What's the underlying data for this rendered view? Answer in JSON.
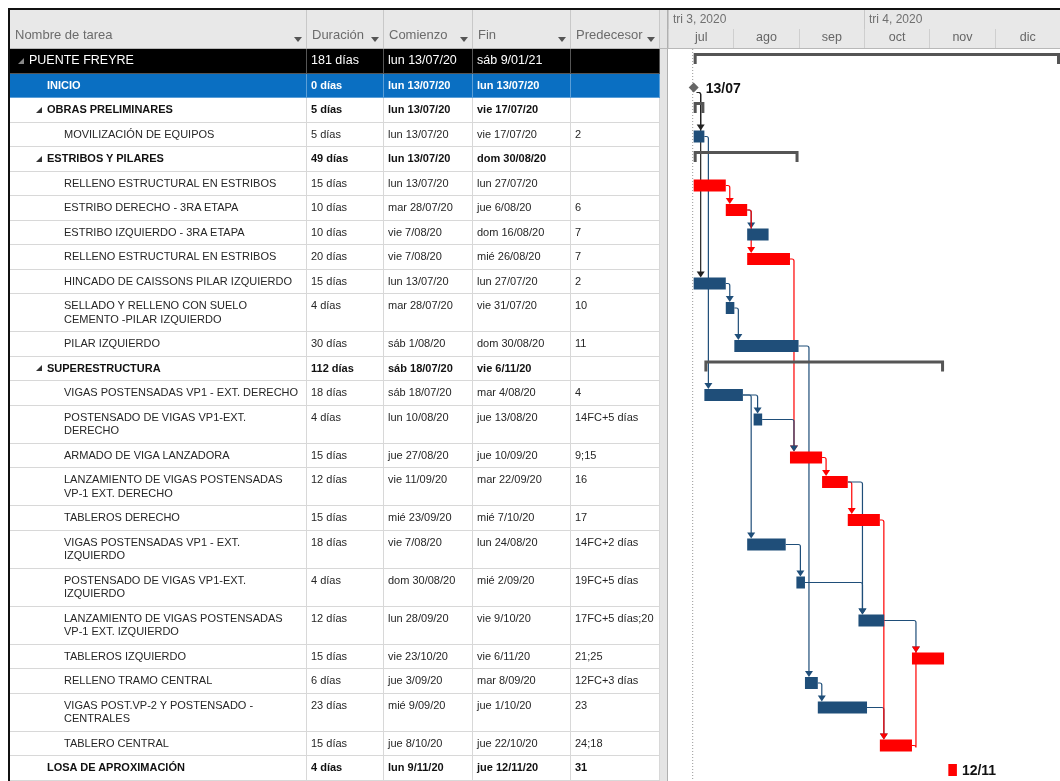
{
  "columns": [
    {
      "label": "Nombre de tarea"
    },
    {
      "label": "Duración"
    },
    {
      "label": "Comienzo"
    },
    {
      "label": "Fin"
    },
    {
      "label": "Predecesor"
    }
  ],
  "timescale": {
    "quarters": [
      {
        "label": "tri 3, 2020"
      },
      {
        "label": "tri 4, 2020"
      }
    ],
    "months": [
      "jul",
      "ago",
      "sep",
      "oct",
      "nov",
      "dic"
    ]
  },
  "tasks": [
    {
      "kind": "project",
      "name": "PUENTE FREYRE",
      "duration": "181 días",
      "start": "lun 13/07/20",
      "finish": "sáb 9/01/21",
      "bold": false,
      "selected": false,
      "expanded": true,
      "children": [
        {
          "kind": "milestone",
          "name": "INICIO",
          "duration": "0 días",
          "start": "lun 13/07/20",
          "finish": "lun 13/07/20",
          "bold": true,
          "selected": true,
          "bar_label": "13/07"
        },
        {
          "kind": "summary",
          "name": "OBRAS PRELIMINARES",
          "duration": "5 días",
          "start": "lun 13/07/20",
          "finish": "vie 17/07/20",
          "bold": true,
          "selected": false,
          "expanded": true,
          "children": [
            {
              "kind": "task",
              "name": "MOVILIZACIÓN DE EQUIPOS",
              "duration": "5 días",
              "start": "lun 13/07/20",
              "finish": "vie 17/07/20",
              "predecessors": "2",
              "bold": false,
              "selected": false,
              "critical": false
            }
          ]
        },
        {
          "kind": "summary",
          "name": "ESTRIBOS Y PILARES",
          "duration": "49 días",
          "start": "lun 13/07/20",
          "finish": "dom 30/08/20",
          "bold": true,
          "selected": false,
          "expanded": true,
          "children": [
            {
              "kind": "task",
              "name": "RELLENO ESTRUCTURAL EN ESTRIBOS",
              "duration": "15 días",
              "start": "lun 13/07/20",
              "finish": "lun 27/07/20",
              "bold": false,
              "selected": false,
              "critical": true
            },
            {
              "kind": "task",
              "name": "ESTRIBO DERECHO - 3RA ETAPA",
              "duration": "10 días",
              "start": "mar 28/07/20",
              "finish": "jue 6/08/20",
              "predecessors": "6",
              "bold": false,
              "selected": false,
              "critical": true
            },
            {
              "kind": "task",
              "name": "ESTRIBO IZQUIERDO - 3RA ETAPA",
              "duration": "10 días",
              "start": "vie 7/08/20",
              "finish": "dom 16/08/20",
              "predecessors": "7",
              "bold": false,
              "selected": false,
              "critical": false
            },
            {
              "kind": "task",
              "name": "RELLENO ESTRUCTURAL EN ESTRIBOS",
              "duration": "20 días",
              "start": "vie 7/08/20",
              "finish": "mié 26/08/20",
              "predecessors": "7",
              "bold": false,
              "selected": false,
              "critical": true
            },
            {
              "kind": "task",
              "name": "HINCADO DE CAISSONS PILAR IZQUIERDO",
              "duration": "15 días",
              "start": "lun 13/07/20",
              "finish": "lun 27/07/20",
              "predecessors": "2",
              "bold": false,
              "selected": false,
              "critical": false
            },
            {
              "kind": "task",
              "name": "SELLADO Y RELLENO CON SUELO CEMENTO -PILAR IZQUIERDO",
              "duration": "4 días",
              "start": "mar 28/07/20",
              "finish": "vie 31/07/20",
              "predecessors": "10",
              "bold": false,
              "selected": false,
              "critical": false
            },
            {
              "kind": "task",
              "name": "PILAR IZQUIERDO",
              "duration": "30 días",
              "start": "sáb 1/08/20",
              "finish": "dom 30/08/20",
              "predecessors": "11",
              "bold": false,
              "selected": false,
              "critical": false
            }
          ]
        },
        {
          "kind": "summary",
          "name": "SUPERESTRUCTURA",
          "duration": "112 días",
          "start": "sáb 18/07/20",
          "finish": "vie 6/11/20",
          "bold": true,
          "selected": false,
          "expanded": true,
          "children": [
            {
              "kind": "task",
              "name": "VIGAS POSTENSADAS VP1 - EXT. DERECHO",
              "duration": "18 días",
              "start": "sáb 18/07/20",
              "finish": "mar 4/08/20",
              "predecessors": "4",
              "bold": false,
              "selected": false,
              "critical": false
            },
            {
              "kind": "task",
              "name": "POSTENSADO DE VIGAS VP1-EXT. DERECHO",
              "duration": "4 días",
              "start": "lun 10/08/20",
              "finish": "jue 13/08/20",
              "predecessors": "14FC+5 días",
              "bold": false,
              "selected": false,
              "critical": false
            },
            {
              "kind": "task",
              "name": "ARMADO DE VIGA LANZADORA",
              "duration": "15 días",
              "start": "jue 27/08/20",
              "finish": "jue 10/09/20",
              "predecessors": "9;15",
              "bold": false,
              "selected": false,
              "critical": true
            },
            {
              "kind": "task",
              "name": "LANZAMIENTO DE VIGAS POSTENSADAS VP-1 EXT. DERECHO",
              "duration": "12 días",
              "start": "vie 11/09/20",
              "finish": "mar 22/09/20",
              "predecessors": "16",
              "bold": false,
              "selected": false,
              "critical": true
            },
            {
              "kind": "task",
              "name": "TABLEROS DERECHO",
              "duration": "15 días",
              "start": "mié 23/09/20",
              "finish": "mié 7/10/20",
              "predecessors": "17",
              "bold": false,
              "selected": false,
              "critical": true
            },
            {
              "kind": "task",
              "name": "VIGAS POSTENSADAS VP1 - EXT. IZQUIERDO",
              "duration": "18 días",
              "start": "vie 7/08/20",
              "finish": "lun 24/08/20",
              "predecessors": "14FC+2 días",
              "bold": false,
              "selected": false,
              "critical": false
            },
            {
              "kind": "task",
              "name": "POSTENSADO DE VIGAS VP1-EXT. IZQUIERDO",
              "duration": "4 días",
              "start": "dom 30/08/20",
              "finish": "mié 2/09/20",
              "predecessors": "19FC+5 días",
              "bold": false,
              "selected": false,
              "critical": false
            },
            {
              "kind": "task",
              "name": "LANZAMIENTO DE VIGAS POSTENSADAS VP-1 EXT. IZQUIERDO",
              "duration": "12 días",
              "start": "lun 28/09/20",
              "finish": "vie 9/10/20",
              "predecessors": "17FC+5 días;20",
              "bold": false,
              "selected": false,
              "critical": false
            },
            {
              "kind": "task",
              "name": "TABLEROS IZQUIERDO",
              "duration": "15 días",
              "start": "vie 23/10/20",
              "finish": "vie 6/11/20",
              "predecessors": "21;25",
              "bold": false,
              "selected": false,
              "critical": true
            },
            {
              "kind": "task",
              "name": "RELLENO TRAMO CENTRAL",
              "duration": "6 días",
              "start": "jue 3/09/20",
              "finish": "mar 8/09/20",
              "predecessors": "12FC+3 días",
              "bold": false,
              "selected": false,
              "critical": false
            },
            {
              "kind": "task",
              "name": "VIGAS POST.VP-2 Y POSTENSADO - CENTRALES",
              "duration": "23 días",
              "start": "mié 9/09/20",
              "finish": "jue 1/10/20",
              "predecessors": "23",
              "bold": false,
              "selected": false,
              "critical": false
            },
            {
              "kind": "task",
              "name": "TABLERO CENTRAL",
              "duration": "15 días",
              "start": "jue 8/10/20",
              "finish": "jue 22/10/20",
              "predecessors": "24;18",
              "bold": false,
              "selected": false,
              "critical": true
            }
          ]
        },
        {
          "kind": "task",
          "name": "LOSA DE APROXIMACIÓN",
          "duration": "4 días",
          "start": "lun 9/11/20",
          "finish": "jue 12/11/20",
          "predecessors": "31",
          "bold": true,
          "selected": false,
          "critical": true,
          "bar_label": "12/11"
        }
      ]
    }
  ]
}
